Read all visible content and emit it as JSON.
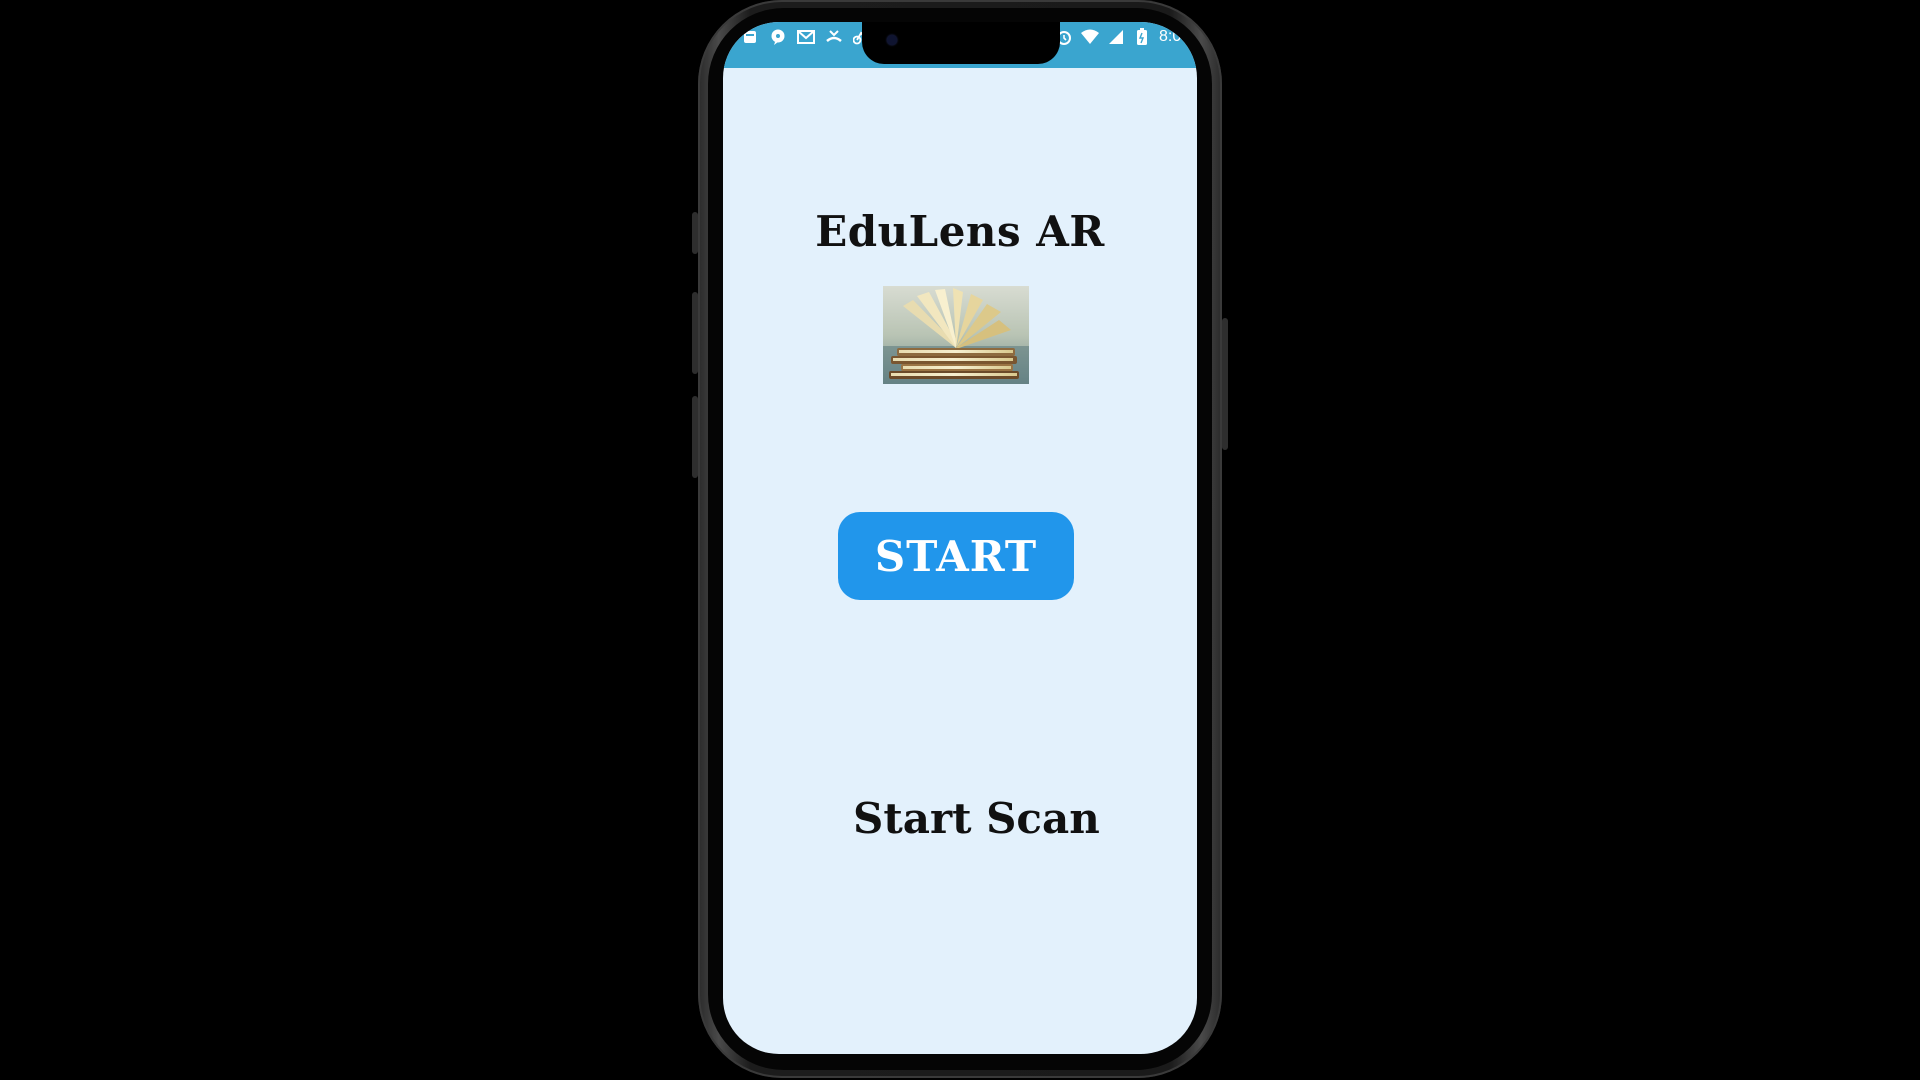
{
  "status_bar": {
    "time": "8:0",
    "left_icons": [
      "notification-icon",
      "chat-icon",
      "mail-icon",
      "missed-call-icon",
      "bike-icon"
    ],
    "right_icons": [
      "alarm-icon",
      "wifi-icon",
      "signal-icon",
      "battery-icon"
    ],
    "color": "#3aa5cf"
  },
  "app": {
    "title": "EduLens AR",
    "image": "book-stack-image",
    "start_button_label": "START",
    "scan_label": "Start Scan",
    "background_color": "#e3f1fc",
    "button_color": "#2196eb"
  }
}
